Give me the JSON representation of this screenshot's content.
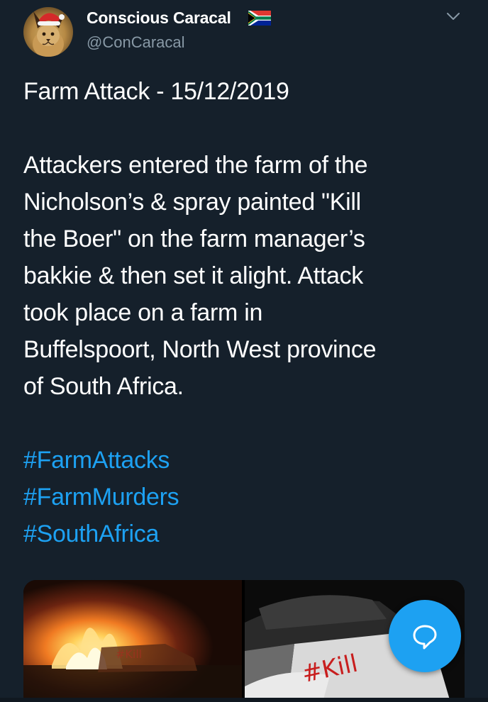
{
  "user": {
    "display_name": "Conscious Caracal",
    "handle": "@ConCaracal",
    "flag_icon": "south-africa-flag-icon",
    "avatar_icon": "caracal-santa-hat-avatar"
  },
  "tweet": {
    "title_line": "Farm Attack - 15/12/2019",
    "body_lines": [
      "Attackers entered the farm of the",
      "Nicholson’s & spray painted \"Kill",
      "the Boer\" on the farm manager’s",
      "bakkie & then set it alight. Attack",
      "took place on a farm in",
      "Buffelspoort, North West province",
      "of South Africa."
    ],
    "hashtags": [
      "#FarmAttacks",
      "#FarmMurders",
      "#SouthAfrica"
    ]
  },
  "media": {
    "photos": [
      {
        "icon": "burning-vehicle-photo"
      },
      {
        "icon": "burnt-vehicle-graffiti-photo"
      }
    ]
  },
  "actions": {
    "menu_icon": "chevron-down-icon",
    "compose_icon": "speech-bubble-icon"
  },
  "colors": {
    "background": "#15202b",
    "accent": "#1da1f2",
    "secondary_text": "#8899a6"
  }
}
